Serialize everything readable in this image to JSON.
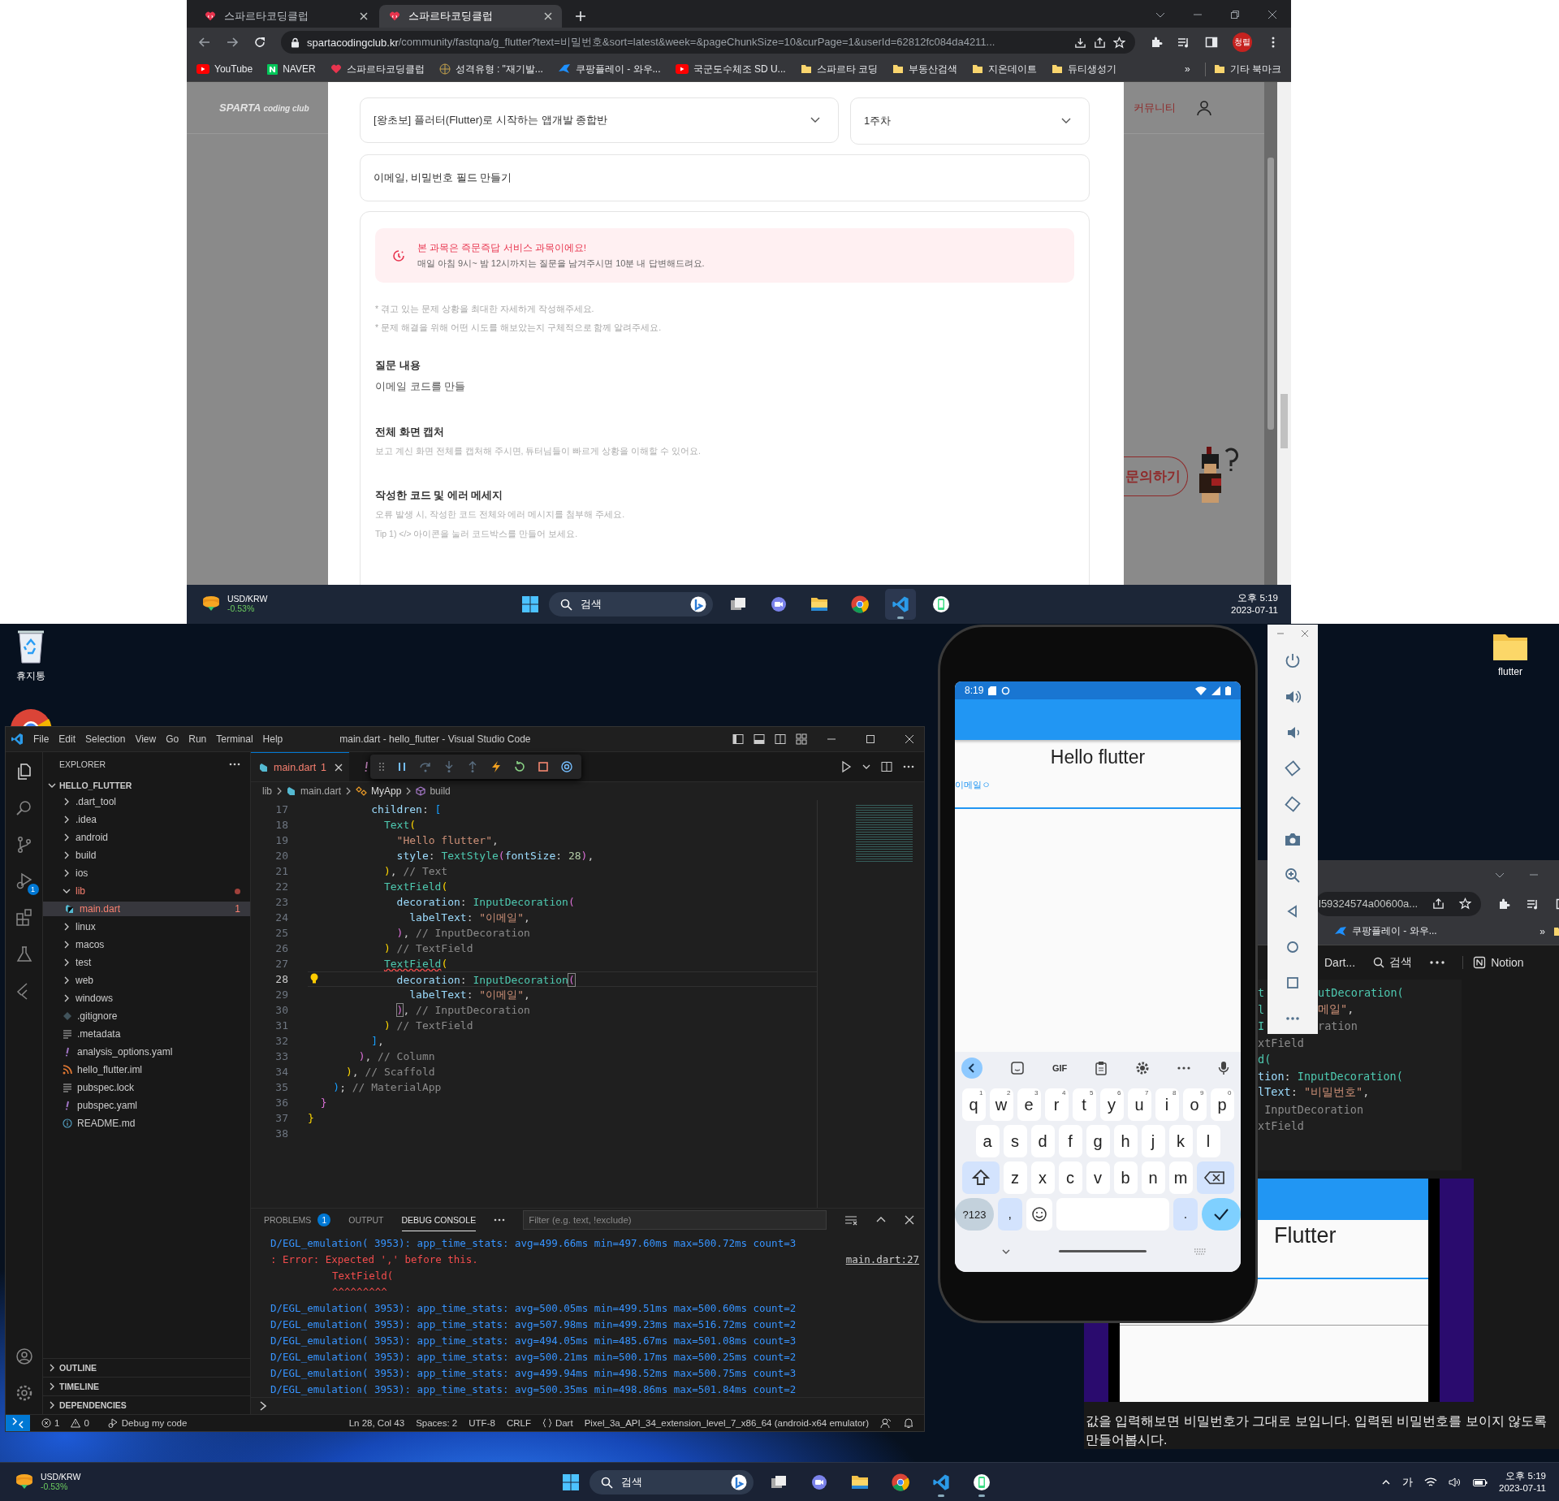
{
  "browser": {
    "tabs": [
      {
        "title": "스파르타코딩클럽",
        "selected": false
      },
      {
        "title": "스파르타코딩클럽",
        "selected": true
      }
    ],
    "url_host": "spartacodingclub.kr",
    "url_path": "/community/fastqna/g_flutter?text=비밀번호&sort=latest&week=&pageChunkSize=10&curPage=1&userId=62812fc084da4211...",
    "profile": "청렬",
    "bookmarks": [
      {
        "label": "YouTube",
        "kind": "youtube"
      },
      {
        "label": "NAVER",
        "kind": "naver"
      },
      {
        "label": "스파르타코딩클럽",
        "kind": "sparta"
      },
      {
        "label": "성격유형 : \"재기발...",
        "kind": "globe"
      },
      {
        "label": "쿠팡플레이 - 와우...",
        "kind": "coupang"
      },
      {
        "label": "국군도수체조 SD U...",
        "kind": "youtube"
      },
      {
        "label": "스파르타 코딩",
        "kind": "folder"
      },
      {
        "label": "부동산검색",
        "kind": "folder"
      },
      {
        "label": "지온데이트",
        "kind": "folder"
      },
      {
        "label": "듀티생성기",
        "kind": "folder"
      }
    ],
    "more": "»",
    "other_bookmarks": "기타 북마크"
  },
  "site": {
    "logo": "SPARTA",
    "logo_sub": "coding club",
    "nav": "커뮤니티",
    "course": "[왕초보] 플러터(Flutter)로 시작하는 앱개발 종합반",
    "week": "1주차",
    "title": "이메일, 비밀번호 필드 만들기",
    "notice_title": "본 과목은 즉문즉답 서비스 과목이에요!",
    "notice_text": "매일 아침 9시~ 밤 12시까지는 질문을 남겨주시면 10분 내 답변해드려요.",
    "hints": [
      "* 겪고 있는 문제 상황을 최대한 자세하게 작성해주세요.",
      "* 문제 해결을 위해 어떤 시도를 해보았는지 구체적으로 함께 알려주세요."
    ],
    "sections": [
      {
        "heading": "질문 내용",
        "kind": "answer",
        "lines": [
          "이메일 코드를 만들"
        ]
      },
      {
        "heading": "전체 화면 캡처",
        "kind": "hint",
        "lines": [
          "보고 계신 화면 전체를 캡처해 주시면, 튜터님들이 빠르게 상황을 이해할 수 있어요."
        ]
      },
      {
        "heading": "작성한 코드 및 에러 메세지",
        "kind": "hint",
        "lines": [
          "오류 발생 시, 작성한 코드 전체와 에러 메시지를 첨부해 주세요.",
          "Tip 1) </> 아이콘을 눌러 코드박스를 만들어 보세요."
        ]
      }
    ],
    "inquiry": "문의하기"
  },
  "taskbars": [
    {
      "widget": "USD/KRW",
      "change": "-0.53%",
      "search": "검색",
      "time": "오후 5:19",
      "date": "2023-07-11",
      "apps": [
        {
          "kind": "taskview",
          "running": false
        },
        {
          "kind": "teams",
          "running": false
        },
        {
          "kind": "explorer",
          "running": false
        },
        {
          "kind": "chrome",
          "running": false
        },
        {
          "kind": "vscode",
          "running": true
        },
        {
          "kind": "app",
          "running": false
        }
      ]
    },
    {
      "widget": "USD/KRW",
      "change": "-0.53%",
      "search": "검색",
      "ime": "가",
      "time": "오후 5:19",
      "date": "2023-07-11",
      "apps": [
        {
          "kind": "taskview",
          "running": false
        },
        {
          "kind": "teams",
          "running": false
        },
        {
          "kind": "explorer",
          "running": false
        },
        {
          "kind": "chrome",
          "running": false
        },
        {
          "kind": "vscode",
          "running": true
        },
        {
          "kind": "app",
          "running": true
        }
      ]
    }
  ],
  "desktop": {
    "recycle_bin": "휴지통",
    "folder": "flutter"
  },
  "vscode": {
    "menu": [
      "File",
      "Edit",
      "Selection",
      "View",
      "Go",
      "Run",
      "Terminal",
      "Help"
    ],
    "title": "main.dart - hello_flutter - Visual Studio Code",
    "run_badge": "1",
    "explorer": "EXPLORER",
    "project": "HELLO_FLUTTER",
    "tree": [
      {
        "name": ".dart_tool",
        "kind": "folder",
        "expanded": false,
        "selected": false,
        "error": false
      },
      {
        "name": ".idea",
        "kind": "folder",
        "expanded": false,
        "selected": false,
        "error": false
      },
      {
        "name": "android",
        "kind": "folder",
        "expanded": false,
        "selected": false,
        "error": false
      },
      {
        "name": "build",
        "kind": "folder",
        "expanded": false,
        "selected": false,
        "error": false
      },
      {
        "name": "ios",
        "kind": "folder",
        "expanded": false,
        "selected": false,
        "error": false
      },
      {
        "name": "lib",
        "kind": "folder",
        "expanded": true,
        "selected": false,
        "error": true,
        "children": [
          {
            "name": "main.dart",
            "kind": "dart",
            "selected": true,
            "error": true,
            "problems": "1"
          }
        ]
      },
      {
        "name": "linux",
        "kind": "folder",
        "expanded": false,
        "selected": false,
        "error": false
      },
      {
        "name": "macos",
        "kind": "folder",
        "expanded": false,
        "selected": false,
        "error": false
      },
      {
        "name": "test",
        "kind": "folder",
        "expanded": false,
        "selected": false,
        "error": false
      },
      {
        "name": "web",
        "kind": "folder",
        "expanded": false,
        "selected": false,
        "error": false
      },
      {
        "name": "windows",
        "kind": "folder",
        "expanded": false,
        "selected": false,
        "error": false
      },
      {
        "name": ".gitignore",
        "kind": "git",
        "selected": false,
        "error": false
      },
      {
        "name": ".metadata",
        "kind": "text",
        "selected": false,
        "error": false
      },
      {
        "name": "analysis_options.yaml",
        "kind": "yaml",
        "selected": false,
        "error": false
      },
      {
        "name": "hello_flutter.iml",
        "kind": "feed",
        "selected": false,
        "error": false
      },
      {
        "name": "pubspec.lock",
        "kind": "text",
        "selected": false,
        "error": false
      },
      {
        "name": "pubspec.yaml",
        "kind": "yaml",
        "selected": false,
        "error": false
      },
      {
        "name": "README.md",
        "kind": "info",
        "selected": false,
        "error": false
      }
    ],
    "sections": [
      "OUTLINE",
      "TIMELINE",
      "DEPENDENCIES"
    ],
    "tab": {
      "name": "main.dart",
      "problems": "1"
    },
    "breadcrumb": [
      "lib",
      "main.dart",
      "MyApp",
      "build"
    ],
    "code": [
      {
        "number": "17",
        "current": false,
        "tokens": [
          {
            "text": "          children",
            "kind": "property"
          },
          {
            "text": ": ",
            "kind": "plain"
          },
          {
            "text": "[",
            "kind": "bracket3"
          }
        ]
      },
      {
        "number": "18",
        "current": false,
        "tokens": [
          {
            "text": "            Text",
            "kind": "class"
          },
          {
            "text": "(",
            "kind": "bracket1"
          }
        ]
      },
      {
        "number": "19",
        "current": false,
        "tokens": [
          {
            "text": "              \"Hello flutter\"",
            "kind": "string"
          },
          {
            "text": ",",
            "kind": "plain"
          }
        ]
      },
      {
        "number": "20",
        "current": false,
        "tokens": [
          {
            "text": "              style",
            "kind": "property"
          },
          {
            "text": ": ",
            "kind": "plain"
          },
          {
            "text": "TextStyle",
            "kind": "class"
          },
          {
            "text": "(",
            "kind": "bracket2"
          },
          {
            "text": "fontSize",
            "kind": "property"
          },
          {
            "text": ": ",
            "kind": "plain"
          },
          {
            "text": "28",
            "kind": "number"
          },
          {
            "text": ")",
            "kind": "bracket2"
          },
          {
            "text": ",",
            "kind": "plain"
          }
        ]
      },
      {
        "number": "21",
        "current": false,
        "tokens": [
          {
            "text": "            )",
            "kind": "bracket1"
          },
          {
            "text": ", ",
            "kind": "plain"
          },
          {
            "text": "// Text",
            "kind": "comment"
          }
        ]
      },
      {
        "number": "22",
        "current": false,
        "tokens": [
          {
            "text": "            TextField",
            "kind": "class"
          },
          {
            "text": "(",
            "kind": "bracket1"
          }
        ]
      },
      {
        "number": "23",
        "current": false,
        "tokens": [
          {
            "text": "              decoration",
            "kind": "property"
          },
          {
            "text": ": ",
            "kind": "plain"
          },
          {
            "text": "InputDecoration",
            "kind": "class"
          },
          {
            "text": "(",
            "kind": "bracket2"
          }
        ]
      },
      {
        "number": "24",
        "current": false,
        "tokens": [
          {
            "text": "                labelText",
            "kind": "property"
          },
          {
            "text": ": ",
            "kind": "plain"
          },
          {
            "text": "\"이메일\"",
            "kind": "string"
          },
          {
            "text": ",",
            "kind": "plain"
          }
        ]
      },
      {
        "number": "25",
        "current": false,
        "tokens": [
          {
            "text": "              )",
            "kind": "bracket2"
          },
          {
            "text": ", ",
            "kind": "plain"
          },
          {
            "text": "// InputDecoration",
            "kind": "comment"
          }
        ]
      },
      {
        "number": "26",
        "current": false,
        "tokens": [
          {
            "text": "            )",
            "kind": "bracket1"
          },
          {
            "text": " // TextField",
            "kind": "comment"
          }
        ]
      },
      {
        "number": "27",
        "current": false,
        "tokens": [
          {
            "text": "            TextField",
            "kind": "error_class"
          },
          {
            "text": "(",
            "kind": "bracket1"
          }
        ]
      },
      {
        "number": "28",
        "current": true,
        "tokens": [
          {
            "text": "              decoration",
            "kind": "property"
          },
          {
            "text": ": ",
            "kind": "plain"
          },
          {
            "text": "InputDecoration",
            "kind": "class"
          },
          {
            "text": "(",
            "kind": "bracket_match"
          }
        ]
      },
      {
        "number": "29",
        "current": false,
        "tokens": [
          {
            "text": "                labelText",
            "kind": "property"
          },
          {
            "text": ": ",
            "kind": "plain"
          },
          {
            "text": "\"이메일\"",
            "kind": "string"
          },
          {
            "text": ",",
            "kind": "plain"
          }
        ]
      },
      {
        "number": "30",
        "current": false,
        "tokens": [
          {
            "text": "              )",
            "kind": "bracket_match"
          },
          {
            "text": ", ",
            "kind": "plain"
          },
          {
            "text": "// InputDecoration",
            "kind": "comment"
          }
        ]
      },
      {
        "number": "31",
        "current": false,
        "tokens": [
          {
            "text": "            )",
            "kind": "bracket1"
          },
          {
            "text": " // TextField",
            "kind": "comment"
          }
        ]
      },
      {
        "number": "32",
        "current": false,
        "tokens": [
          {
            "text": "          ]",
            "kind": "bracket3"
          },
          {
            "text": ",",
            "kind": "plain"
          }
        ]
      },
      {
        "number": "33",
        "current": false,
        "tokens": [
          {
            "text": "        )",
            "kind": "bracket2"
          },
          {
            "text": ", ",
            "kind": "plain"
          },
          {
            "text": "// Column",
            "kind": "comment"
          }
        ]
      },
      {
        "number": "34",
        "current": false,
        "tokens": [
          {
            "text": "      )",
            "kind": "bracket1"
          },
          {
            "text": ", ",
            "kind": "plain"
          },
          {
            "text": "// Scaffold",
            "kind": "comment"
          }
        ]
      },
      {
        "number": "35",
        "current": false,
        "tokens": [
          {
            "text": "    )",
            "kind": "bracket3"
          },
          {
            "text": "; ",
            "kind": "plain"
          },
          {
            "text": "// MaterialApp",
            "kind": "comment"
          }
        ]
      },
      {
        "number": "36",
        "current": false,
        "tokens": [
          {
            "text": "  }",
            "kind": "bracket2"
          }
        ]
      },
      {
        "number": "37",
        "current": false,
        "tokens": [
          {
            "text": "}",
            "kind": "bracket1"
          }
        ]
      },
      {
        "number": "38",
        "current": false
      }
    ],
    "panel_tabs": [
      {
        "label": "PROBLEMS",
        "badge": "1",
        "selected": false
      },
      {
        "label": "OUTPUT",
        "selected": false
      },
      {
        "label": "DEBUG CONSOLE",
        "selected": true
      }
    ],
    "filter_placeholder": "Filter (e.g. text, !exclude)",
    "console": [
      {
        "kind": "log",
        "text": "D/EGL_emulation( 3953): app_time_stats: avg=499.66ms min=497.60ms max=500.72ms count=3"
      },
      {
        "kind": "error",
        "text": ": Error: Expected ',' before this.",
        "link": "main.dart:27"
      },
      {
        "kind": "error_detail",
        "text": "TextField("
      },
      {
        "kind": "error_detail",
        "text": "^^^^^^^^^"
      },
      {
        "kind": "log",
        "text": "D/EGL_emulation( 3953): app_time_stats: avg=500.05ms min=499.51ms max=500.60ms count=2"
      },
      {
        "kind": "log",
        "text": "D/EGL_emulation( 3953): app_time_stats: avg=507.98ms min=499.23ms max=516.72ms count=2"
      },
      {
        "kind": "log",
        "text": "D/EGL_emulation( 3953): app_time_stats: avg=494.05ms min=485.67ms max=501.08ms count=3"
      },
      {
        "kind": "log",
        "text": "D/EGL_emulation( 3953): app_time_stats: avg=500.21ms min=500.17ms max=500.25ms count=2"
      },
      {
        "kind": "log",
        "text": "D/EGL_emulation( 3953): app_time_stats: avg=499.94ms min=498.52ms max=500.75ms count=3"
      },
      {
        "kind": "log",
        "text": "D/EGL_emulation( 3953): app_time_stats: avg=500.35ms min=498.86ms max=501.84ms count=2"
      }
    ],
    "status": {
      "errors": "1",
      "warnings": "0",
      "debug": "Debug my code",
      "items": [
        "Ln 28, Col 43",
        "Spaces: 2",
        "UTF-8",
        "CRLF"
      ],
      "language": "Dart",
      "device": "Pixel_3a_API_34_extension_level_7_x86_64 (android-x64 emulator)"
    }
  },
  "phone": {
    "time": "8:19",
    "title": "Hello flutter",
    "field_label": "이메일ㅇ",
    "gif": "GIF",
    "rows": [
      [
        {
          "label": "q",
          "hint": "1"
        },
        {
          "label": "w",
          "hint": "2"
        },
        {
          "label": "e",
          "hint": "3"
        },
        {
          "label": "r",
          "hint": "4"
        },
        {
          "label": "t",
          "hint": "5"
        },
        {
          "label": "y",
          "hint": "6"
        },
        {
          "label": "u",
          "hint": "7"
        },
        {
          "label": "i",
          "hint": "8"
        },
        {
          "label": "o",
          "hint": "9"
        },
        {
          "label": "p",
          "hint": "0"
        }
      ],
      [
        {
          "label": "a"
        },
        {
          "label": "s"
        },
        {
          "label": "d"
        },
        {
          "label": "f"
        },
        {
          "label": "g"
        },
        {
          "label": "h"
        },
        {
          "label": "j"
        },
        {
          "label": "k"
        },
        {
          "label": "l"
        }
      ],
      [
        {
          "label": "z"
        },
        {
          "label": "x"
        },
        {
          "label": "c"
        },
        {
          "label": "v"
        },
        {
          "label": "b"
        },
        {
          "label": "n"
        },
        {
          "label": "m"
        }
      ]
    ],
    "symbols": "?123",
    "comma": ",",
    "period": "."
  },
  "bg_window": {
    "url": "l59324574a00600a...",
    "bookmark": "쿠팡플레이 - 와우...",
    "more": "»",
    "doc_title": "Dart...",
    "search": "검색",
    "notion": "Notion",
    "code": [
      {
        "left": "t",
        "tokens": [
          {
            "text": "utDecoration(",
            "kind": "class"
          }
        ]
      },
      {
        "left": "l",
        "tokens": [
          {
            "text": "메일\"",
            "kind": "string"
          },
          {
            "text": ",",
            "kind": "plain"
          }
        ]
      },
      {
        "left": "I",
        "tokens": [
          {
            "text": "ration",
            "kind": "comment"
          }
        ]
      },
      {
        "tokens": [
          {
            "text": "xtField",
            "kind": "comment"
          }
        ]
      },
      {
        "tokens": [
          {
            "text": "d(",
            "kind": "class"
          }
        ]
      },
      {
        "tokens": [
          {
            "text": "tion",
            "kind": "property"
          },
          {
            "text": ": ",
            "kind": "plain"
          },
          {
            "text": "InputDecoration(",
            "kind": "class"
          }
        ]
      },
      {
        "tokens": [
          {
            "text": "lText",
            "kind": "property"
          },
          {
            "text": ": ",
            "kind": "plain"
          },
          {
            "text": "\"비밀번호\"",
            "kind": "string"
          },
          {
            "text": ",",
            "kind": "plain"
          }
        ]
      },
      {
        "tokens": [
          {
            "text": " InputDecoration",
            "kind": "comment"
          }
        ]
      },
      {
        "tokens": [
          {
            "text": "xtField",
            "kind": "comment"
          }
        ]
      }
    ],
    "app_title": "Flutter",
    "caption": "값을 입력해보면 비밀번호가 그대로 보입니다. 입력된 비밀번호를 보이지 않도록 만들어봅시다."
  }
}
